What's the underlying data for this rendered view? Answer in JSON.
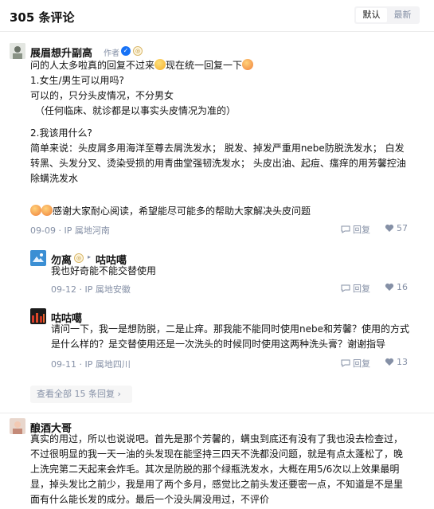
{
  "header": {
    "title": "305 条评论",
    "sort_default": "默认",
    "sort_latest": "最新"
  },
  "comment1": {
    "author": "展眉想升副高",
    "author_tag": "作者",
    "lines": [
      "问的人太多啦真的回复不过来",
      "现在统一回复一下",
      "1.女生/男生可以用吗?",
      "可以的，只分头皮情况，不分男女",
      "（任何临床、就诊都是以事实头皮情况为准的）",
      "2.我该用什么?",
      "简单来说：头皮屑多用海洋至尊去屑洗发水；  脱发、掉发严重用nebe防脱洗发水；  白发",
      "转黑、头发分叉、烫染受损的用青曲堂强韧洗发水；  头皮出油、起痘、瘙痒的用芳馨控油",
      "除螨洗发水",
      "感谢大家耐心阅读，希望能尽可能多的帮助大家解决头皮问题"
    ],
    "meta": "09-09 · IP 属地河南",
    "reply_label": "回复",
    "like_count": "57"
  },
  "reply1": {
    "author": "勿离",
    "reply_to": "咕咕噶",
    "text": "我也好奇能不能交替使用",
    "meta": "09-12 · IP 属地安徽",
    "reply_label": "回复",
    "like_count": "16"
  },
  "reply2": {
    "author": "咕咕噶",
    "lines": [
      "请问一下，我一是想防脱，二是止痒。那我能不能同时使用nebe和芳馨？使用的方式",
      "是什么样的？是交替使用还是一次洗头的时候同时使用这两种洗头膏？谢谢指导"
    ],
    "meta": "09-11 · IP 属地四川",
    "reply_label": "回复",
    "like_count": "13"
  },
  "view_more": "查看全部 15 条回复",
  "comment2": {
    "author": "酿酒大哥",
    "lines": [
      "真实的用过，所以也说说吧。首先是那个芳馨的，螨虫到底还有没有了我也没去检查过，",
      "不过很明显的我一天一油的头发现在能坚持三四天不洗都没问题，就是有点太蓬松了，晚",
      "上洗完第二天起来会炸毛。其次是防脱的那个绿瓶洗发水，大概在用5/6次以上效果最明",
      "显，掉头发比之前少，我是用了两个多月，感觉比之前头发还要密一点，不知道是不是里",
      "面有什么能长发的成分。最后一个没头屑没用过，不评价"
    ]
  },
  "colors": {
    "accent": "#1772f6",
    "meta": "#8590a6",
    "text": "#121212"
  }
}
